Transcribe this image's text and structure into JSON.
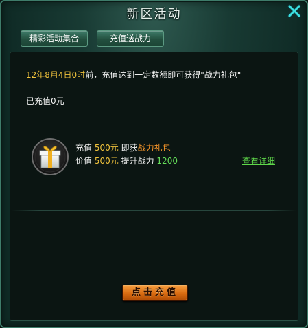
{
  "window": {
    "title": "新区活动",
    "close_icon": "close-x-icon",
    "accent_color": "#3ce0e0"
  },
  "tabs": [
    {
      "label": "精彩活动集合"
    },
    {
      "label": "充值送战力"
    }
  ],
  "notice": {
    "date": "12年8月4日0时",
    "text": "前，充值达到一定数额即可获得\"战力礼包\""
  },
  "recharged": "已充值0元",
  "reward": {
    "icon": "gift-box-icon",
    "line1_prefix": "充值",
    "line1_amount": "500元",
    "line1_mid": "即获",
    "line1_item": "战力礼包",
    "line2_prefix": "价值",
    "line2_amount": "500元",
    "line2_mid": "提升战力",
    "line2_value": "1200"
  },
  "detail_link": "查看详细",
  "recharge_button": "点击充值"
}
